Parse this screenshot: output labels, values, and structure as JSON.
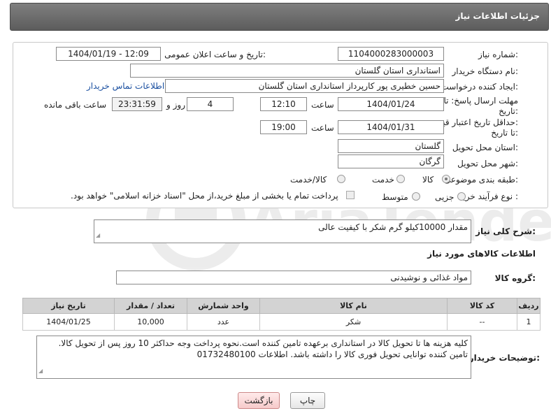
{
  "header": {
    "title": "جزئیات اطلاعات نیاز"
  },
  "form": {
    "need_number_label": "شماره نیاز:",
    "need_number": "1104000283000003",
    "announce_label": "تاریخ و ساعت اعلان عمومی:",
    "announce_value": "1404/01/19 - 12:09",
    "buyer_org_label": "نام دستگاه خریدار:",
    "buyer_org": "استانداری استان گلستان",
    "creator_label": "ایجاد کننده درخواست:",
    "creator": "حسین خطیری پور کارپرداز استانداری استان گلستان",
    "contact_link": "اطلاعات تماس خریدار",
    "deadline_label_1": "مهلت ارسال پاسخ: تا",
    "deadline_label_2": "تاریخ:",
    "deadline_date": "1404/01/24",
    "time_label": "ساعت",
    "deadline_time": "12:10",
    "days_value": "4",
    "days_label": "روز و",
    "remaining_value": "23:31:59",
    "remaining_label": "ساعت باقی مانده",
    "validity_label_1": "حداقل تاریخ اعتبار قیمت:",
    "validity_label_2": "تا تاریخ:",
    "validity_date": "1404/01/31",
    "validity_time": "19:00",
    "delivery_province_label": "استان محل تحویل:",
    "delivery_province": "گلستان",
    "delivery_city_label": "شهر محل تحویل:",
    "delivery_city": "گرگان",
    "category_label": "طبقه بندی موضوعی:",
    "category_options": [
      "کالا",
      "خدمت",
      "کالا/خدمت"
    ],
    "category_selected": "کالا",
    "process_label": "نوع فرآیند خرید :",
    "process_options": [
      "جزیی",
      "متوسط"
    ],
    "payment_note": "پرداخت تمام یا بخشی از مبلغ خرید،از محل \"اسناد خزانه اسلامی\" خواهد بود."
  },
  "description": {
    "label": "شرح کلی نیاز:",
    "text": "مقدار 10000کیلو گرم شکر با کیفیت عالی"
  },
  "goods": {
    "section_title": "اطلاعات کالاهای مورد نیاز",
    "group_label": "گروه کالا:",
    "group_value": "مواد غذائی و نوشیدنی",
    "columns": [
      "ردیف",
      "کد کالا",
      "نام کالا",
      "واحد شمارش",
      "تعداد / مقدار",
      "تاریخ نیاز"
    ],
    "rows": [
      [
        "1",
        "--",
        "شکر",
        "عدد",
        "10,000",
        "1404/01/25"
      ]
    ]
  },
  "buyer_notes": {
    "label": "توضیحات خریدار:",
    "text": "کلیه هزینه ها تا تحویل کالا در استانداری برعهده تامین کننده است.نحوه پرداخت وجه حداکثر 10 روز پس از تحویل کالا. تامین کننده توانایی تحویل فوری کالا را داشته باشد. اطلاعات 01732480100"
  },
  "buttons": {
    "print": "چاپ",
    "back": "بازگشت"
  },
  "watermark_text": "AriaTender.neT"
}
